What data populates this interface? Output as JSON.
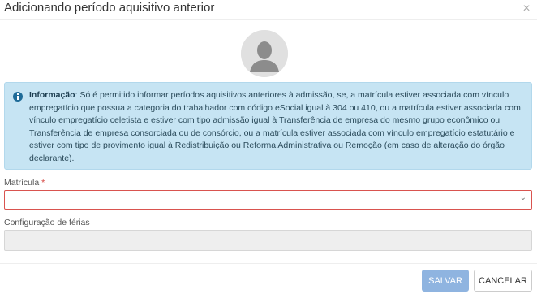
{
  "dialog": {
    "title": "Adicionando período aquisitivo anterior",
    "close_glyph": "×"
  },
  "avatar": {
    "icon": "user-silhouette-icon"
  },
  "info": {
    "icon": "info-circle-icon",
    "heading": "Informação",
    "separator": ": ",
    "text": "Só é permitido informar períodos aquisitivos anteriores à admissão, se, a matrícula estiver associada com vínculo empregatício que possua a categoria do trabalhador com código eSocial igual à 304 ou 410, ou a matrícula estiver associada com vínculo empregatício celetista e estiver com tipo admissão igual à Transferência de empresa do mesmo grupo econômico ou Transferência de empresa consorciada ou de consórcio, ou a matrícula estiver associada com vínculo empregatício estatutário e estiver com tipo de provimento igual à Redistribuição ou Reforma Administrativa ou Remoção (em caso de alteração do órgão declarante).",
    "colors": {
      "background": "#c6e4f3",
      "icon": "#1e6b98"
    }
  },
  "form": {
    "matricula": {
      "label": "Matrícula",
      "required_mark": "*",
      "value": "",
      "icon": "chevron-down-icon",
      "chevron_glyph": "⌄"
    },
    "configuracao": {
      "label": "Configuração de férias",
      "value": ""
    }
  },
  "footer": {
    "save_label": "SALVAR",
    "cancel_label": "CANCELAR",
    "colors": {
      "save": "#8fb4e0",
      "error": "#d9534f"
    }
  }
}
